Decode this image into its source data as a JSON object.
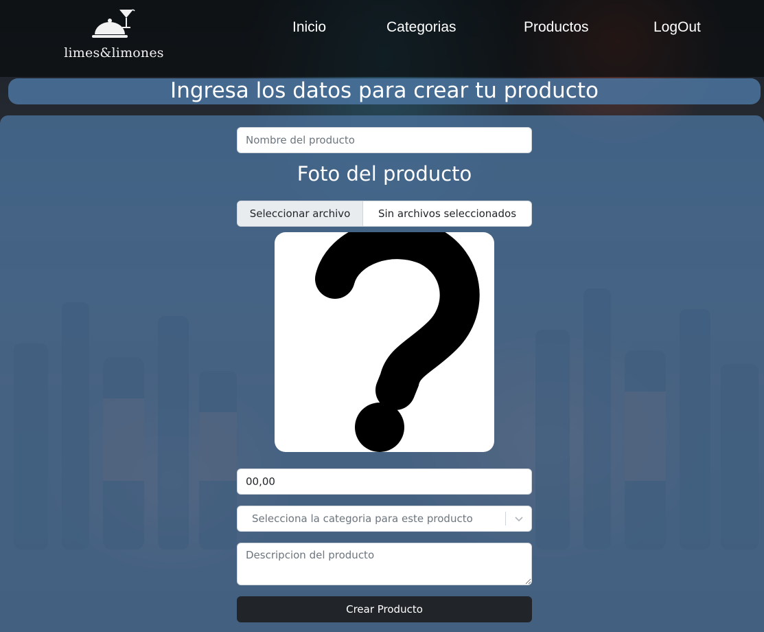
{
  "nav": {
    "brand": "limes&limones",
    "links": [
      "Inicio",
      "Categorias",
      "Productos",
      "LogOut"
    ]
  },
  "header": {
    "title": "Ingresa los datos para crear tu producto"
  },
  "form": {
    "name_placeholder": "Nombre del producto",
    "photo_label": "Foto del producto",
    "file_button_label": "Seleccionar archivo",
    "file_status": "Sin archivos seleccionados",
    "preview_icon": "question-mark-icon",
    "price_value": "00,00",
    "category_placeholder": "Selecciona la categoria para este producto",
    "description_placeholder": "Descripcion del producto",
    "submit_label": "Crear Producto"
  },
  "colors": {
    "navbar": "#0a0c0e",
    "accent_panel": "#4a729c",
    "submit_button": "#212529"
  }
}
